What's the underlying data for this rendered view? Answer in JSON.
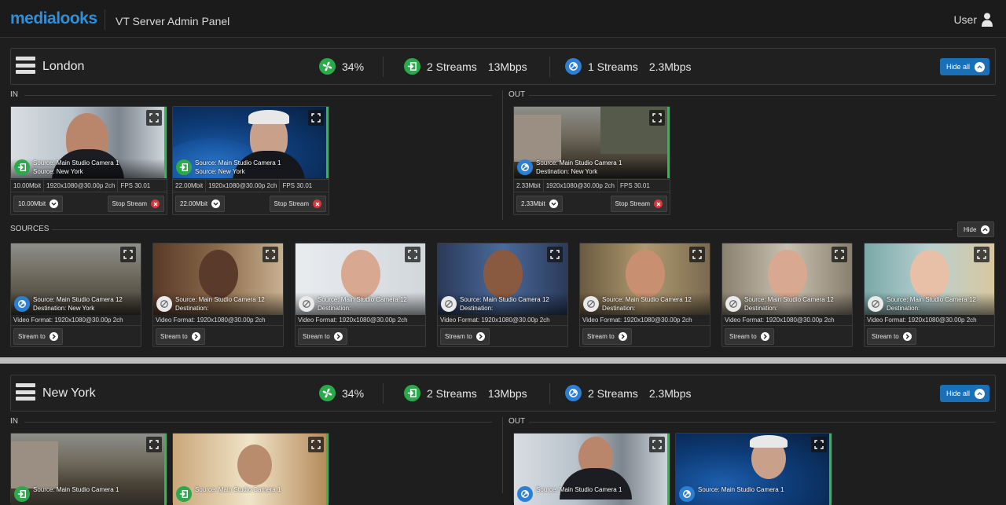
{
  "app": {
    "logo": "medialooks",
    "title": "VT Server Admin Panel",
    "user": "User"
  },
  "colors": {
    "accent": "#1b6fb5",
    "green": "#2ca94b",
    "blue": "#2d7fd3",
    "stop": "#d9343a"
  },
  "london": {
    "name": "London",
    "cpu": "34%",
    "in_streams": "2 Streams",
    "in_rate": "13Mbps",
    "out_streams": "1 Streams",
    "out_rate": "2.3Mbps",
    "hide_all": "Hide all",
    "in_label": "IN",
    "out_label": "OUT",
    "in_cards": [
      {
        "src1": "Source: Main Studio Camera 1",
        "src2": "Source: New York",
        "bitrate": "10.00Mbit",
        "format": "1920x1080@30.00p 2ch",
        "fps": "FPS 30.01",
        "select": "10.00Mbit",
        "stop": "Stop Stream"
      },
      {
        "src1": "Source: Main Studio Camera 1",
        "src2": "Source: New York",
        "bitrate": "22.00Mbit",
        "format": "1920x1080@30.00p 2ch",
        "fps": "FPS 30.01",
        "select": "22.00Mbit",
        "stop": "Stop Stream"
      }
    ],
    "out_cards": [
      {
        "src1": "Source: Main Studio Camera 1",
        "src2": "Destination: New York",
        "bitrate": "2.33Mbit",
        "format": "1920x1080@30.00p 2ch",
        "fps": "FPS 30.01",
        "select": "2.33Mbit",
        "stop": "Stop Stream"
      }
    ],
    "sources_label": "SOURCES",
    "hide": "Hide",
    "sources": [
      {
        "l1": "Source: Main Studio Camera 12",
        "l2": "Destination: New York",
        "fmt": "Video Format: 1920x1080@30.00p 2ch",
        "btn": "Stream to"
      },
      {
        "l1": "Source: Main Studio Camera 12",
        "l2": "Destination:",
        "fmt": "Video Format: 1920x1080@30.00p 2ch",
        "btn": "Stream to"
      },
      {
        "l1": "Source: Main Studio Camera 12",
        "l2": "Destination:",
        "fmt": "Video Format: 1920x1080@30.00p 2ch",
        "btn": "Stream to"
      },
      {
        "l1": "Source: Main Studio Camera 12",
        "l2": "Destination:",
        "fmt": "Video Format: 1920x1080@30.00p 2ch",
        "btn": "Stream to"
      },
      {
        "l1": "Source: Main Studio Camera 12",
        "l2": "Destination:",
        "fmt": "Video Format: 1920x1080@30.00p 2ch",
        "btn": "Stream to"
      },
      {
        "l1": "Source: Main Studio Camera 12",
        "l2": "Destination:",
        "fmt": "Video Format: 1920x1080@30.00p 2ch",
        "btn": "Stream to"
      },
      {
        "l1": "Source: Main Studio Camera 12",
        "l2": "Destination:",
        "fmt": "Video Format: 1920x1080@30.00p 2ch",
        "btn": "Stream to"
      }
    ]
  },
  "newyork": {
    "name": "New York",
    "cpu": "34%",
    "in_streams": "2 Streams",
    "in_rate": "13Mbps",
    "out_streams": "2 Streams",
    "out_rate": "2.3Mbps",
    "hide_all": "Hide all",
    "in_label": "IN",
    "out_label": "OUT",
    "in_cards": [
      {
        "src1": "Source: Main Studio Camera 1"
      },
      {
        "src1": "Source: Main Studio Camera 1"
      }
    ],
    "out_cards": [
      {
        "src1": "Source: Main Studio Camera 1"
      },
      {
        "src1": "Source: Main Studio Camera 1"
      }
    ]
  }
}
